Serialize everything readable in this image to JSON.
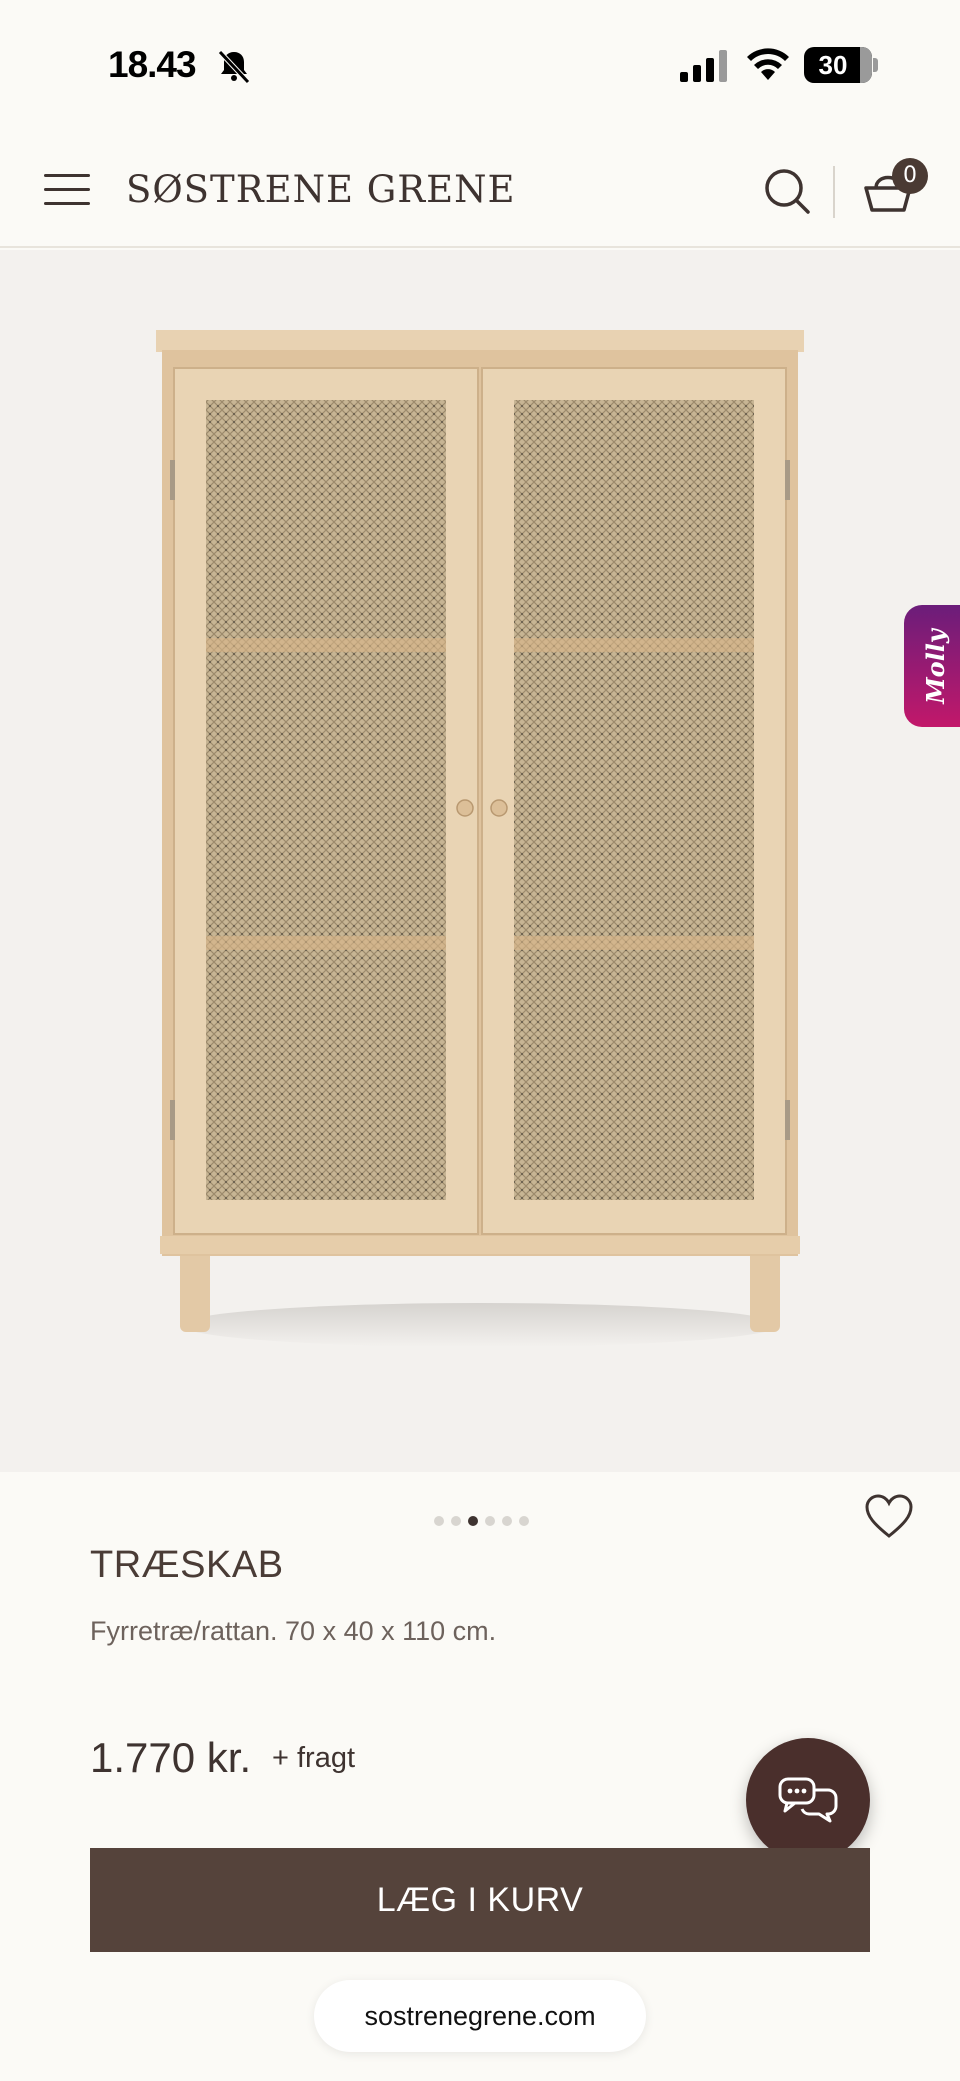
{
  "status_bar": {
    "time": "18.43",
    "battery_level": "30",
    "icons": [
      "bell-muted-icon",
      "signal-icon",
      "wifi-icon",
      "battery-icon"
    ]
  },
  "header": {
    "logo_text": "SØSTRENE GRENE",
    "cart_count": "0",
    "icons": [
      "menu-icon",
      "search-icon",
      "basket-icon"
    ]
  },
  "gallery": {
    "slide_count": 6,
    "active_slide": 3,
    "side_tab_label": "Molly"
  },
  "product": {
    "title": "TRÆSKAB",
    "description": "Fyrretræ/rattan. 70 x 40 x 110 cm.",
    "price": "1.770 kr.",
    "shipping_note": "+ fragt",
    "add_to_cart_label": "LÆG I KURV"
  },
  "browser": {
    "url": "sostrenegrene.com"
  },
  "colors": {
    "primary_brown": "#55433b",
    "chat_button": "#4a2f2c",
    "molly_gradient_start": "#6b1d7a",
    "molly_gradient_end": "#c2186a",
    "background": "#fbfaf6"
  }
}
